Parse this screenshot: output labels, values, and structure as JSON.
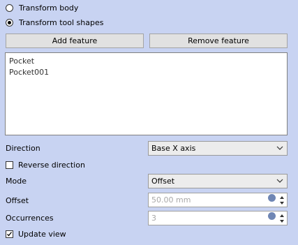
{
  "mode_options": {
    "transform_body": "Transform body",
    "transform_tool_shapes": "Transform tool shapes",
    "selected": "transform_tool_shapes"
  },
  "toolbar": {
    "add_feature": "Add feature",
    "remove_feature": "Remove feature"
  },
  "features": [
    "Pocket",
    "Pocket001"
  ],
  "direction": {
    "label": "Direction",
    "value": "Base X axis"
  },
  "reverse_direction": {
    "label": "Reverse direction",
    "checked": false
  },
  "mode": {
    "label": "Mode",
    "value": "Offset"
  },
  "offset": {
    "label": "Offset",
    "value": "50.00 mm"
  },
  "occurrences": {
    "label": "Occurrences",
    "value": "3"
  },
  "update_view": {
    "label": "Update view",
    "checked": true
  },
  "colors": {
    "panel_bg": "#c8d3f2",
    "button_bg": "#e1e1e1",
    "field_bg": "#ffffff",
    "disabled_text": "#a8a8a8"
  }
}
